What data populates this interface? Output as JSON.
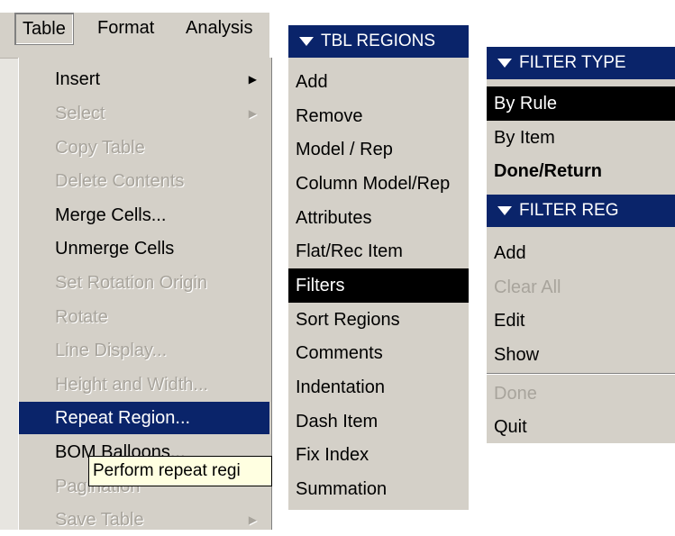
{
  "menubar": {
    "items": [
      {
        "label": "Table"
      },
      {
        "label": "Format"
      },
      {
        "label": "Analysis"
      }
    ]
  },
  "table_menu": {
    "items": [
      {
        "label": "Insert",
        "enabled": true,
        "submenu": true
      },
      {
        "label": "Select",
        "enabled": false,
        "submenu": true
      },
      {
        "label": "Copy Table",
        "enabled": false
      },
      {
        "label": "Delete Contents",
        "enabled": false
      },
      {
        "label": "Merge Cells...",
        "enabled": true
      },
      {
        "label": "Unmerge Cells",
        "enabled": true
      },
      {
        "label": "Set Rotation Origin",
        "enabled": false
      },
      {
        "label": "Rotate",
        "enabled": false
      },
      {
        "label": "Line Display...",
        "enabled": false
      },
      {
        "label": "Height and Width...",
        "enabled": false
      },
      {
        "label": "Repeat Region...",
        "enabled": true,
        "selected": true
      },
      {
        "label": "BOM Balloons...",
        "enabled": true
      },
      {
        "label": "Pagination",
        "enabled": false
      },
      {
        "label": "Save Table",
        "enabled": false,
        "submenu": true
      }
    ],
    "tooltip": "Perform repeat regi"
  },
  "tbl_regions": {
    "title": "TBL REGIONS",
    "items": [
      {
        "label": "Add"
      },
      {
        "label": "Remove"
      },
      {
        "label": "Model / Rep"
      },
      {
        "label": "Column Model/Rep"
      },
      {
        "label": "Attributes"
      },
      {
        "label": "Flat/Rec Item"
      },
      {
        "label": "Filters",
        "selected": true
      },
      {
        "label": "Sort Regions"
      },
      {
        "label": "Comments"
      },
      {
        "label": "Indentation"
      },
      {
        "label": "Dash Item"
      },
      {
        "label": "Fix Index"
      },
      {
        "label": "Summation"
      }
    ]
  },
  "filter_type": {
    "title": "FILTER TYPE",
    "items": [
      {
        "label": "By Rule",
        "selected": true
      },
      {
        "label": "By Item"
      },
      {
        "label": "Done/Return",
        "bold": true
      }
    ]
  },
  "filter_reg": {
    "title": "FILTER REG",
    "items": [
      {
        "label": "Add"
      },
      {
        "label": "Clear All",
        "enabled": false
      },
      {
        "label": "Edit"
      },
      {
        "label": "Show"
      },
      {
        "label": "Done",
        "enabled": false
      },
      {
        "label": "Quit"
      }
    ]
  },
  "colors": {
    "menu_bg": "#d4d0c8",
    "highlight": "#0a246a",
    "disabled": "#a8a49c",
    "tooltip_bg": "#ffffe1"
  }
}
